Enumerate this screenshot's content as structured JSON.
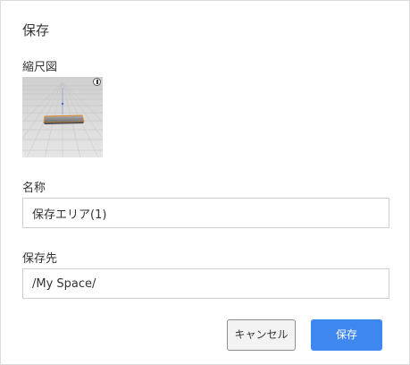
{
  "dialog": {
    "title": "保存",
    "thumbnail_label": "縮尺図",
    "name_label": "名称",
    "name_value": "保存エリア(1)",
    "destination_label": "保存先",
    "destination_value": "/My Space/",
    "cancel_label": "キャンセル",
    "save_label": "保存"
  },
  "colors": {
    "primary": "#3d87ef",
    "field_border": "#cfcfcf",
    "cancel_border": "#8c8c8c"
  },
  "icons": {
    "thumbnail_corner": "compass-icon"
  }
}
